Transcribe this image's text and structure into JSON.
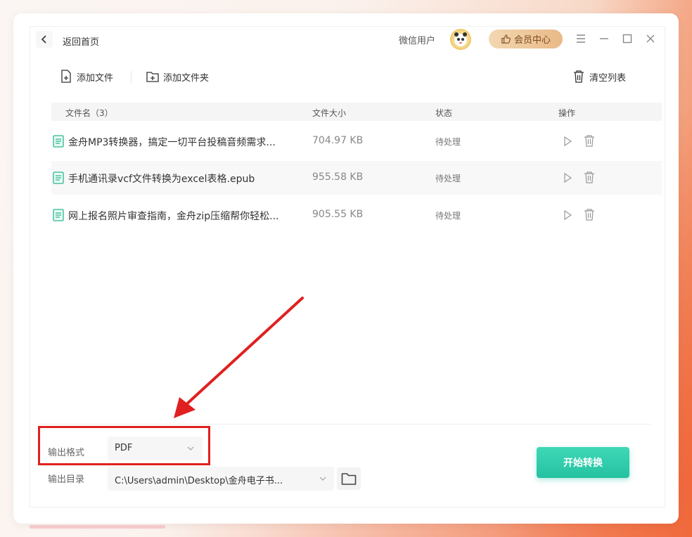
{
  "titlebar": {
    "back_label": "返回首页",
    "user_name": "微信用户",
    "vip_label": "会员中心"
  },
  "toolbar": {
    "add_file": "添加文件",
    "add_folder": "添加文件夹",
    "clear_list": "清空列表"
  },
  "table": {
    "headers": {
      "name": "文件名（3）",
      "size": "文件大小",
      "status": "状态",
      "actions": "操作"
    },
    "rows": [
      {
        "name": "金舟MP3转换器，搞定一切平台投稿音频需求...",
        "size": "704.97 KB",
        "status": "待处理"
      },
      {
        "name": "手机通讯录vcf文件转换为excel表格.epub",
        "size": "955.58 KB",
        "status": "待处理"
      },
      {
        "name": "网上报名照片审查指南，金舟zip压缩帮你轻松...",
        "size": "905.55 KB",
        "status": "待处理"
      }
    ]
  },
  "output": {
    "format_label": "输出格式",
    "format_value": "PDF",
    "dir_label": "输出目录",
    "dir_value": "C:\\Users\\admin\\Desktop\\金舟电子书...",
    "start_label": "开始转换"
  },
  "colors": {
    "accent": "#24c2a1",
    "vip": "#e9b987",
    "annotation": "#e02020"
  },
  "icons": {
    "back": "chevron-left-icon",
    "menu": "hamburger-icon",
    "minimize": "minimize-icon",
    "maximize": "maximize-icon",
    "close": "close-icon",
    "file": "document-icon",
    "play": "play-icon",
    "delete": "trash-icon",
    "folder": "folder-icon"
  }
}
